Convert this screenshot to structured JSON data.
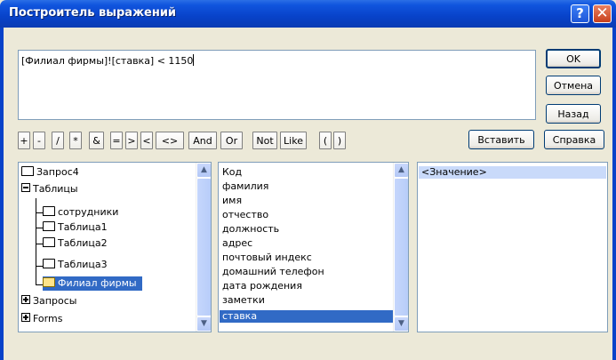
{
  "window": {
    "title": "Построитель выражений",
    "help_label": "?",
    "close_label": "✕"
  },
  "expression": "[Филиал фирмы]![ставка] < 1150",
  "buttons": {
    "ok": "OK",
    "cancel": "Отмена",
    "back": "Назад",
    "insert": "Вставить",
    "help": "Справка"
  },
  "operators": [
    "+",
    "-",
    "/",
    "*",
    "&",
    "=",
    ">",
    "<",
    "<>",
    "And",
    "Or",
    "Not",
    "Like",
    "(",
    ")"
  ],
  "tree": [
    {
      "label": "Запрос4",
      "icon": "folder-icon"
    },
    {
      "label": "Таблицы",
      "icon": "folder-icon"
    },
    {
      "label": "сотрудники",
      "icon": "folder-icon"
    },
    {
      "label": "Таблица1",
      "icon": "folder-icon"
    },
    {
      "label": "Таблица2",
      "icon": "folder-icon"
    },
    {
      "label": "Таблица3",
      "icon": "folder-icon"
    },
    {
      "label": "Филиал фирмы",
      "icon": "open-folder-icon",
      "selected": true
    },
    {
      "label": "Запросы",
      "icon": "expand-icon"
    },
    {
      "label": "Forms",
      "icon": "expand-icon"
    }
  ],
  "fields": [
    "Код",
    "фамилия",
    "имя",
    "отчество",
    "должность",
    "адрес",
    "почтовый индекс",
    "домашний телефон",
    "дата рождения",
    "заметки",
    "ставка"
  ],
  "fields_selected": "ставка",
  "values": [
    "<Значение>"
  ],
  "colors": {
    "title_bar": "#0842c9",
    "selection": "#316ac5",
    "dialog_bg": "#ece9d8"
  }
}
